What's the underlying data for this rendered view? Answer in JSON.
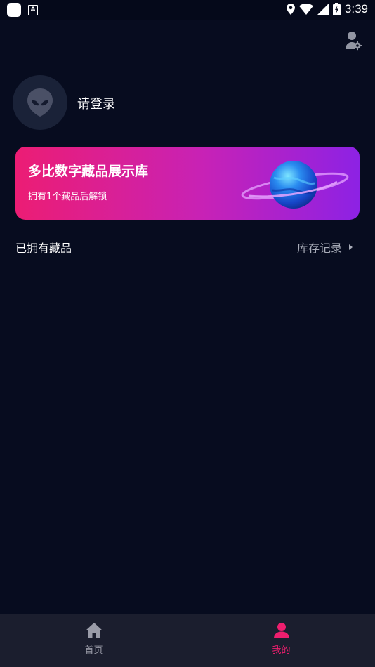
{
  "status_bar": {
    "time": "3:39"
  },
  "profile": {
    "login_text": "请登录"
  },
  "banner": {
    "title": "多比数字藏品展示库",
    "subtitle": "拥有1个藏品后解锁"
  },
  "collection": {
    "owned_label": "已拥有藏品",
    "record_link": "库存记录"
  },
  "bottom_nav": {
    "items": [
      {
        "label": "首页",
        "icon": "home-icon",
        "active": false
      },
      {
        "label": "我的",
        "icon": "person-icon",
        "active": true
      }
    ]
  },
  "colors": {
    "background": "#070c1f",
    "accent": "#ee1e6e",
    "banner_gradient_start": "#ec1d74",
    "banner_gradient_end": "#8d22e4",
    "nav_background": "#1b1e2e"
  }
}
